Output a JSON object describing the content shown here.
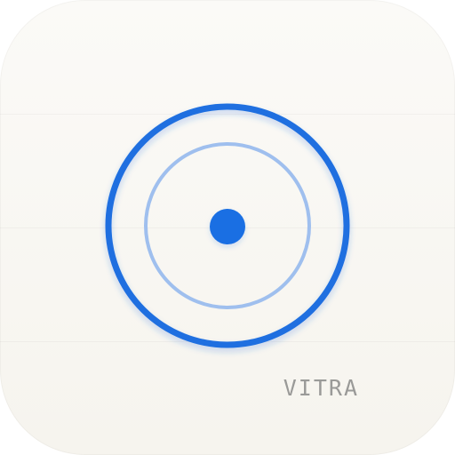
{
  "brand": {
    "wordmark": "VITRA"
  },
  "colors": {
    "tile_background": "#f8f6f1",
    "outer_ring": "#1f6fe0",
    "inner_ring": "#9fbfee",
    "center_dot": "#1a6fe3",
    "wordmark": "#9a9a98"
  }
}
